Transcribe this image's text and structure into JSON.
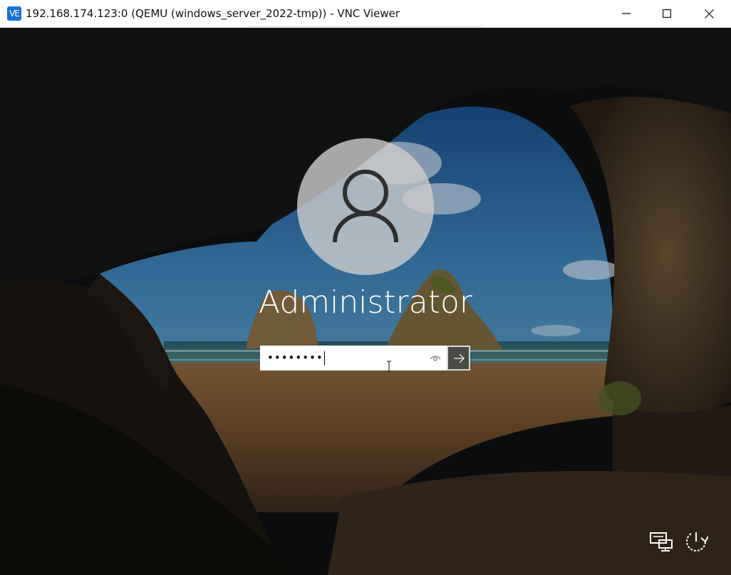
{
  "window": {
    "app_icon_text": "VE",
    "title": "192.168.174.123:0 (QEMU (windows_server_2022-tmp)) - VNC Viewer",
    "buttons": {
      "minimize": "minimize-icon",
      "maximize": "maximize-icon",
      "close": "close-icon"
    }
  },
  "login": {
    "username": "Administrator",
    "password_masked": "••••••••",
    "reveal_icon": "eye-icon",
    "submit_icon": "arrow-right-icon",
    "avatar_icon": "user-icon"
  },
  "bottom_right": {
    "network_icon": "network-icon",
    "power_icon": "power-icon"
  }
}
